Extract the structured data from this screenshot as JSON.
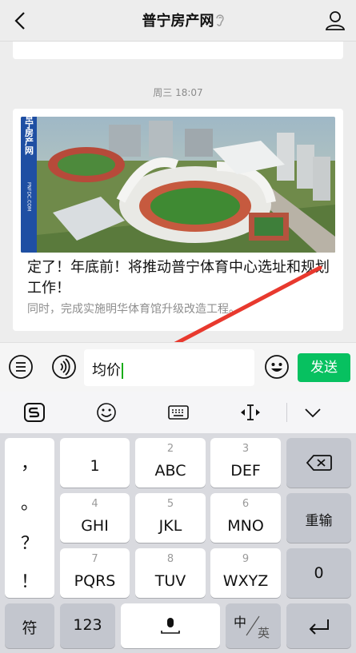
{
  "header": {
    "title": "普宁房产网",
    "icons": [
      "back-icon",
      "ear-icon",
      "user-icon"
    ]
  },
  "chat": {
    "timestamp": "周三 18:07",
    "card": {
      "image_text": "普宁房产网",
      "image_url_text": "PNFDC.COM",
      "title": "定了！年底前！将推动普宁体育中心选址和规划工作！",
      "desc": "同时，完成实施明华体育馆升级改造工程。"
    }
  },
  "inputbar": {
    "value": "均价",
    "send_label": "发送",
    "icons": [
      "list-icon",
      "voice-icon",
      "emoji-icon"
    ]
  },
  "toolbar": {
    "icons": [
      "sogou-logo-icon",
      "emoji-icon",
      "keyboard-icon",
      "cursor-move-icon",
      "collapse-icon"
    ]
  },
  "keyboard": {
    "punct": [
      "，",
      "。",
      "？",
      "！"
    ],
    "rows": [
      [
        {
          "num": "",
          "lbl": "1"
        },
        {
          "num": "2",
          "lbl": "ABC"
        },
        {
          "num": "3",
          "lbl": "DEF"
        }
      ],
      [
        {
          "num": "4",
          "lbl": "GHI"
        },
        {
          "num": "5",
          "lbl": "JKL"
        },
        {
          "num": "6",
          "lbl": "MNO"
        }
      ],
      [
        {
          "num": "7",
          "lbl": "PQRS"
        },
        {
          "num": "8",
          "lbl": "TUV"
        },
        {
          "num": "9",
          "lbl": "WXYZ"
        }
      ]
    ],
    "retype": "重输",
    "zero": "0",
    "symbol": "符",
    "numbers": "123",
    "lang_cn": "中",
    "lang_en": "英"
  },
  "colors": {
    "send": "#07c160",
    "cursor": "#1aad19"
  }
}
